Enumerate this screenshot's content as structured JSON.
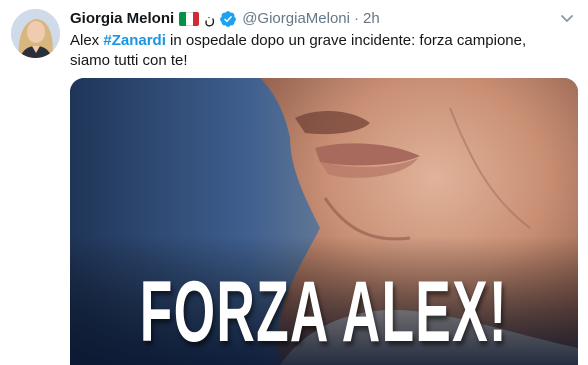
{
  "tweet": {
    "display_name": "Giorgia Meloni",
    "flag_icon": "italy-flag-icon",
    "name_symbol": "ن",
    "verified_icon": "verified-badge-icon",
    "handle": "@GiorgiaMeloni",
    "separator": "·",
    "time": "2h",
    "menu_icon": "chevron-down-icon",
    "text_before": "Alex ",
    "hashtag": "#Zanardi",
    "text_after": " in ospedale dopo un grave incidente: forza campione, siamo tutti con te!",
    "media": {
      "banner_text": "FORZA ALEX!"
    }
  },
  "colors": {
    "name": "#14171a",
    "secondary": "#657786",
    "link": "#1b95e0",
    "verified": "#1da1f2",
    "flag": [
      "#009246",
      "#ffffff",
      "#ce2b37"
    ]
  }
}
